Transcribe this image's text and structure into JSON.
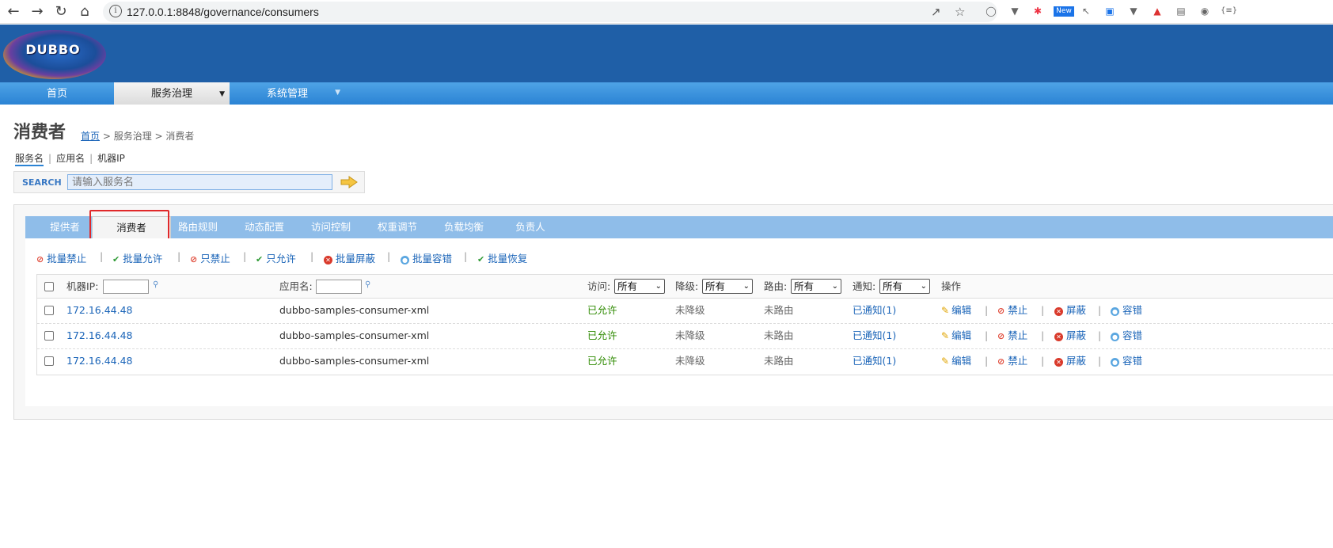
{
  "browser": {
    "url": "127.0.0.1:8848/governance/consumers",
    "new_badge": "New"
  },
  "header": {
    "logo": "DUBBO"
  },
  "mainnav": [
    {
      "label": "首页"
    },
    {
      "label": "服务治理"
    },
    {
      "label": "系统管理"
    }
  ],
  "page": {
    "title": "消费者",
    "breadcrumb": {
      "home": "首页",
      "rest": "> 服务治理 > 消费者"
    }
  },
  "search": {
    "tabs": [
      "服务名",
      "应用名",
      "机器IP"
    ],
    "label": "SEARCH",
    "placeholder": "请输入服务名"
  },
  "subtabs": [
    "提供者",
    "消费者",
    "路由规则",
    "动态配置",
    "访问控制",
    "权重调节",
    "负载均衡",
    "负责人"
  ],
  "batch": [
    "批量禁止",
    "批量允许",
    "只禁止",
    "只允许",
    "批量屏蔽",
    "批量容错",
    "批量恢复"
  ],
  "table": {
    "headers": {
      "ip": "机器IP:",
      "app": "应用名:",
      "access": "访问:",
      "degrade": "降级:",
      "route": "路由:",
      "notify": "通知:",
      "ops": "操作"
    },
    "filter_value": "所有",
    "rows": [
      {
        "ip": "172.16.44.48",
        "app": "dubbo-samples-consumer-xml",
        "access": "已允许",
        "degrade": "未降级",
        "route": "未路由",
        "notify": "已通知(1)"
      },
      {
        "ip": "172.16.44.48",
        "app": "dubbo-samples-consumer-xml",
        "access": "已允许",
        "degrade": "未降级",
        "route": "未路由",
        "notify": "已通知(1)"
      },
      {
        "ip": "172.16.44.48",
        "app": "dubbo-samples-consumer-xml",
        "access": "已允许",
        "degrade": "未降级",
        "route": "未路由",
        "notify": "已通知(1)"
      }
    ],
    "ops": [
      "编辑",
      "禁止",
      "屏蔽",
      "容错"
    ]
  }
}
